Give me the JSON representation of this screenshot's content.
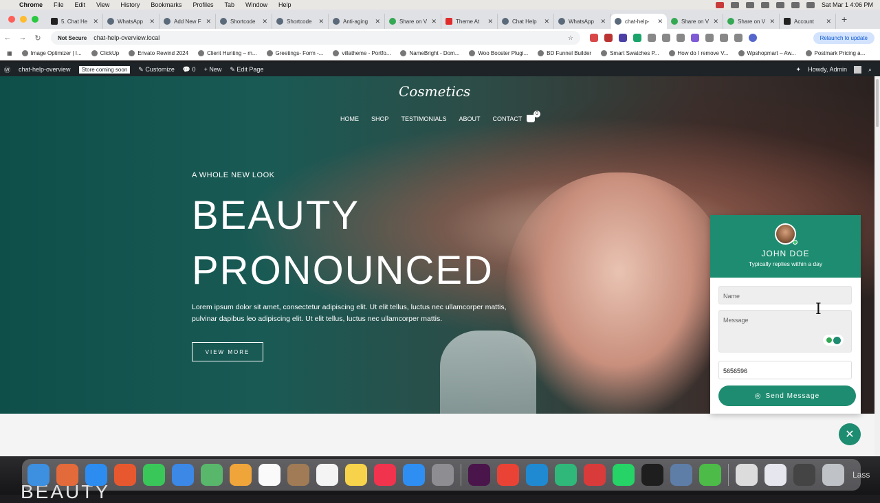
{
  "menubar": {
    "items": [
      "Chrome",
      "File",
      "Edit",
      "View",
      "History",
      "Bookmarks",
      "Profiles",
      "Tab",
      "Window",
      "Help"
    ],
    "clock": "Sat Mar 1  4:06 PM"
  },
  "tabs": [
    {
      "label": "5. Chat He",
      "icon": "doc"
    },
    {
      "label": "WhatsApp",
      "icon": "wordpress"
    },
    {
      "label": "Add New F",
      "icon": "wordpress"
    },
    {
      "label": "Shortcode",
      "icon": "wordpress"
    },
    {
      "label": "Shortcode",
      "icon": "wordpress"
    },
    {
      "label": "Anti-aging",
      "icon": "wordpress"
    },
    {
      "label": "Share on V",
      "icon": "globe"
    },
    {
      "label": "Theme At",
      "icon": "youtube"
    },
    {
      "label": "Chat Help",
      "icon": "wordpress"
    },
    {
      "label": "WhatsApp",
      "icon": "wordpress"
    },
    {
      "label": "chat-help-",
      "icon": "wordpress",
      "active": true
    },
    {
      "label": "Share on V",
      "icon": "globe"
    },
    {
      "label": "Share on V",
      "icon": "globe"
    },
    {
      "label": "Account",
      "icon": "dark"
    }
  ],
  "address": {
    "security": "Not Secure",
    "url": "chat-help-overview.local",
    "relaunch": "Relaunch to update"
  },
  "bookmarks": [
    "Image Optimizer | I...",
    "ClickUp",
    "Envato Rewind 2024",
    "Client Hunting – m...",
    "Greetings- Form -...",
    "villatheme - Portfo...",
    "NameBright - Dom...",
    "Woo Booster Plugi...",
    "BD Funnel Builder",
    "Smart Swatches P...",
    "How do I remove V...",
    "Wpshopmart – Aw...",
    "Postmark Pricing a..."
  ],
  "wpbar": {
    "site": "chat-help-overview",
    "badge": "Store coming soon",
    "customize": "Customize",
    "comments": "0",
    "new": "New",
    "edit": "Edit Page",
    "howdy": "Howdy, Admin"
  },
  "site": {
    "logo": "Cosmetics",
    "nav": [
      "HOME",
      "SHOP",
      "TESTIMONIALS",
      "ABOUT",
      "CONTACT"
    ],
    "cart_count": "0",
    "eyebrow": "A WHOLE NEW LOOK",
    "headline_1": "BEAUTY",
    "headline_2": "PRONOUNCED",
    "body": "Lorem ipsum dolor sit amet, consectetur adipiscing elit. Ut elit tellus, luctus nec ullamcorper mattis, pulvinar dapibus leo adipiscing elit. Ut elit tellus, luctus nec ullamcorper mattis.",
    "cta": "VIEW MORE"
  },
  "chat": {
    "name": "JOHN DOE",
    "status": "Typically replies within a day",
    "name_placeholder": "Name",
    "message_placeholder": "Message",
    "phone_value": "5656596",
    "send_label": "Send Message",
    "close_glyph": "✕"
  },
  "desktop": {
    "bg_text": "BEAUTY",
    "side_text": "Lass"
  },
  "colors": {
    "accent": "#1e8c71",
    "wpbar": "#1d2327"
  }
}
